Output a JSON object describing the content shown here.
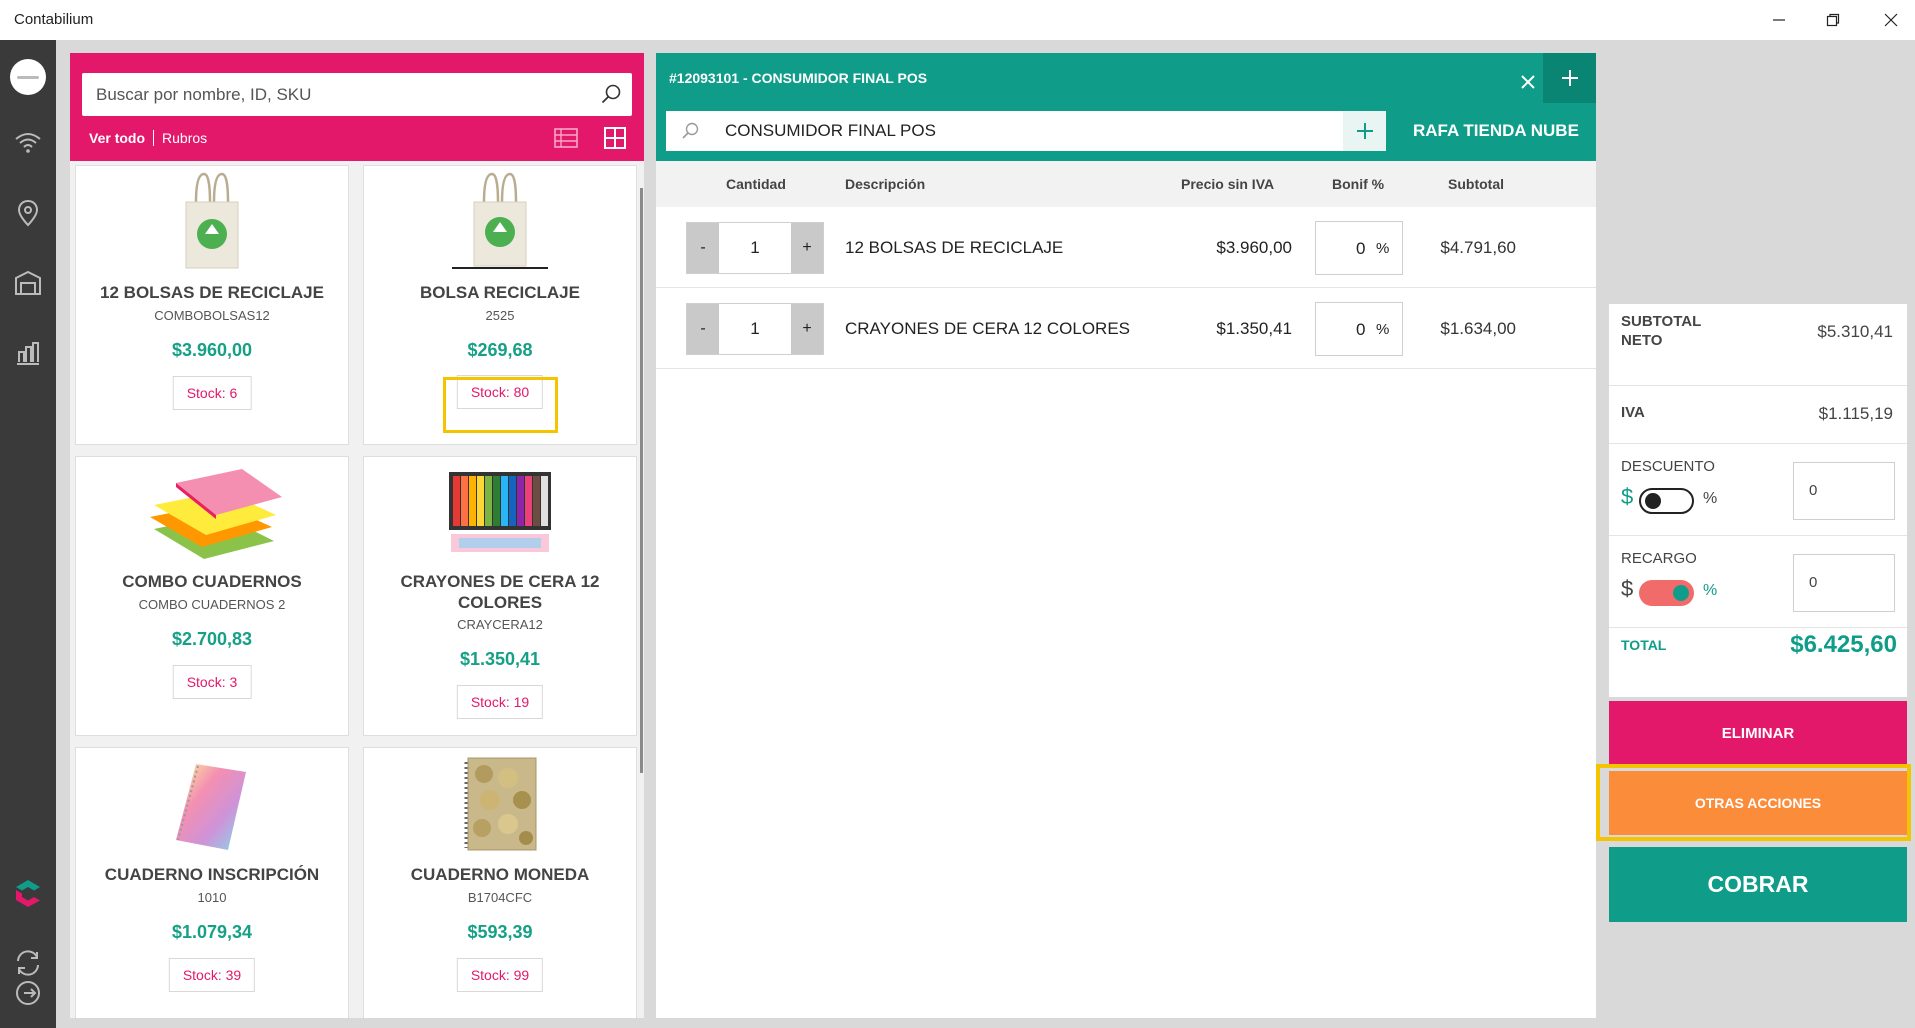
{
  "window": {
    "title": "Contabilium"
  },
  "catalog": {
    "search_placeholder": "Buscar por nombre, ID, SKU",
    "filter_all": "Ver todo",
    "filter_categories": "Rubros",
    "products": [
      {
        "name": "12 BOLSAS DE RECICLAJE",
        "sku": "COMBOBOLSAS12",
        "price": "$3.960,00",
        "stock": "Stock: 6"
      },
      {
        "name": "BOLSA RECICLAJE",
        "sku": "2525",
        "price": "$269,68",
        "stock": "Stock: 80"
      },
      {
        "name": "COMBO CUADERNOS",
        "sku": "COMBO CUADERNOS 2",
        "price": "$2.700,83",
        "stock": "Stock: 3"
      },
      {
        "name": "CRAYONES DE CERA 12 COLORES",
        "sku": "CRAYCERA12",
        "price": "$1.350,41",
        "stock": "Stock: 19"
      },
      {
        "name": "CUADERNO INSCRIPCIÓN",
        "sku": "1010",
        "price": "$1.079,34",
        "stock": "Stock: 39"
      },
      {
        "name": "CUADERNO MONEDA",
        "sku": "B1704CFC",
        "price": "$593,39",
        "stock": "Stock: 99"
      }
    ]
  },
  "order": {
    "title": "#12093101 - CONSUMIDOR FINAL POS",
    "customer": "CONSUMIDOR FINAL POS",
    "store": "RAFA TIENDA NUBE",
    "columns": {
      "qty": "Cantidad",
      "desc": "Descripción",
      "price": "Precio sin IVA",
      "bonif": "Bonif %",
      "subtotal": "Subtotal"
    },
    "minus": "-",
    "plus": "+",
    "percent": "%",
    "items": [
      {
        "qty": "1",
        "desc": "12 BOLSAS DE RECICLAJE",
        "price": "$3.960,00",
        "bonif": "0",
        "subtotal": "$4.791,60"
      },
      {
        "qty": "1",
        "desc": "CRAYONES DE CERA 12 COLORES",
        "price": "$1.350,41",
        "bonif": "0",
        "subtotal": "$1.634,00"
      }
    ]
  },
  "totals": {
    "subtotal_label_1": "SUBTOTAL",
    "subtotal_label_2": "NETO",
    "subtotal": "$5.310,41",
    "iva_label": "IVA",
    "iva": "$1.115,19",
    "discount_label": "DESCUENTO",
    "discount_value": "0",
    "surcharge_label": "RECARGO",
    "surcharge_value": "0",
    "currency_symbol": "$",
    "percent_symbol": "%",
    "total_label": "TOTAL",
    "total": "$6.425,60"
  },
  "actions": {
    "delete": "ELIMINAR",
    "other": "OTRAS ACCIONES",
    "charge": "COBRAR"
  },
  "colors": {
    "brand_pink": "#e3186a",
    "brand_teal": "#0f9d8a",
    "orange": "#fb8c3a",
    "highlight": "#f5c400"
  }
}
